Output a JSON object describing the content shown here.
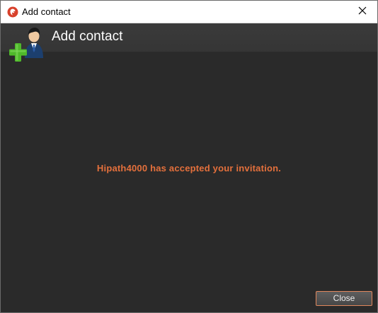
{
  "window": {
    "title": "Add contact",
    "app_icon": "app-logo-icon",
    "close_icon": "close-icon"
  },
  "header": {
    "title": "Add contact",
    "icon": "add-contact-icon"
  },
  "main": {
    "message": "Hipath4000 has accepted your invitation."
  },
  "footer": {
    "close_label": "Close"
  },
  "colors": {
    "background": "#2a2a2a",
    "header_band": "#383838",
    "message": "#e4703c",
    "button_border": "#e0875c",
    "titlebar": "#ffffff"
  }
}
